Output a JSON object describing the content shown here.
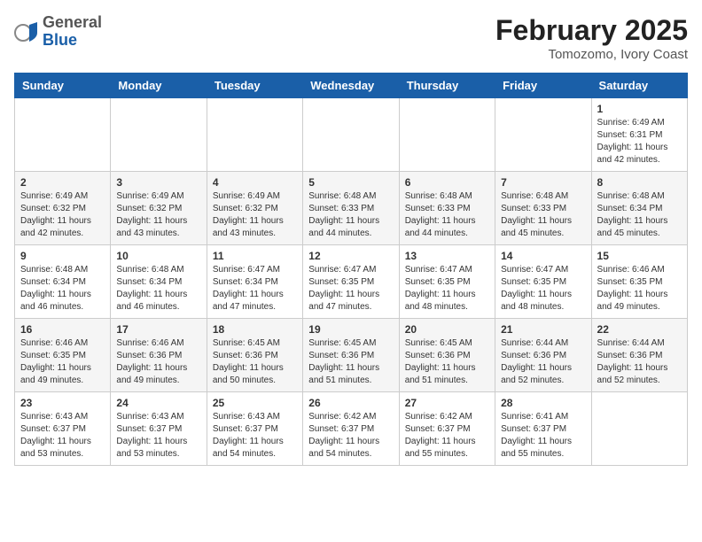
{
  "app": {
    "name_general": "General",
    "name_blue": "Blue"
  },
  "header": {
    "month_title": "February 2025",
    "location": "Tomozomo, Ivory Coast"
  },
  "days_of_week": [
    "Sunday",
    "Monday",
    "Tuesday",
    "Wednesday",
    "Thursday",
    "Friday",
    "Saturday"
  ],
  "weeks": [
    [
      {
        "day": "",
        "info": ""
      },
      {
        "day": "",
        "info": ""
      },
      {
        "day": "",
        "info": ""
      },
      {
        "day": "",
        "info": ""
      },
      {
        "day": "",
        "info": ""
      },
      {
        "day": "",
        "info": ""
      },
      {
        "day": "1",
        "info": "Sunrise: 6:49 AM\nSunset: 6:31 PM\nDaylight: 11 hours and 42 minutes."
      }
    ],
    [
      {
        "day": "2",
        "info": "Sunrise: 6:49 AM\nSunset: 6:32 PM\nDaylight: 11 hours and 42 minutes."
      },
      {
        "day": "3",
        "info": "Sunrise: 6:49 AM\nSunset: 6:32 PM\nDaylight: 11 hours and 43 minutes."
      },
      {
        "day": "4",
        "info": "Sunrise: 6:49 AM\nSunset: 6:32 PM\nDaylight: 11 hours and 43 minutes."
      },
      {
        "day": "5",
        "info": "Sunrise: 6:48 AM\nSunset: 6:33 PM\nDaylight: 11 hours and 44 minutes."
      },
      {
        "day": "6",
        "info": "Sunrise: 6:48 AM\nSunset: 6:33 PM\nDaylight: 11 hours and 44 minutes."
      },
      {
        "day": "7",
        "info": "Sunrise: 6:48 AM\nSunset: 6:33 PM\nDaylight: 11 hours and 45 minutes."
      },
      {
        "day": "8",
        "info": "Sunrise: 6:48 AM\nSunset: 6:34 PM\nDaylight: 11 hours and 45 minutes."
      }
    ],
    [
      {
        "day": "9",
        "info": "Sunrise: 6:48 AM\nSunset: 6:34 PM\nDaylight: 11 hours and 46 minutes."
      },
      {
        "day": "10",
        "info": "Sunrise: 6:48 AM\nSunset: 6:34 PM\nDaylight: 11 hours and 46 minutes."
      },
      {
        "day": "11",
        "info": "Sunrise: 6:47 AM\nSunset: 6:34 PM\nDaylight: 11 hours and 47 minutes."
      },
      {
        "day": "12",
        "info": "Sunrise: 6:47 AM\nSunset: 6:35 PM\nDaylight: 11 hours and 47 minutes."
      },
      {
        "day": "13",
        "info": "Sunrise: 6:47 AM\nSunset: 6:35 PM\nDaylight: 11 hours and 48 minutes."
      },
      {
        "day": "14",
        "info": "Sunrise: 6:47 AM\nSunset: 6:35 PM\nDaylight: 11 hours and 48 minutes."
      },
      {
        "day": "15",
        "info": "Sunrise: 6:46 AM\nSunset: 6:35 PM\nDaylight: 11 hours and 49 minutes."
      }
    ],
    [
      {
        "day": "16",
        "info": "Sunrise: 6:46 AM\nSunset: 6:35 PM\nDaylight: 11 hours and 49 minutes."
      },
      {
        "day": "17",
        "info": "Sunrise: 6:46 AM\nSunset: 6:36 PM\nDaylight: 11 hours and 49 minutes."
      },
      {
        "day": "18",
        "info": "Sunrise: 6:45 AM\nSunset: 6:36 PM\nDaylight: 11 hours and 50 minutes."
      },
      {
        "day": "19",
        "info": "Sunrise: 6:45 AM\nSunset: 6:36 PM\nDaylight: 11 hours and 51 minutes."
      },
      {
        "day": "20",
        "info": "Sunrise: 6:45 AM\nSunset: 6:36 PM\nDaylight: 11 hours and 51 minutes."
      },
      {
        "day": "21",
        "info": "Sunrise: 6:44 AM\nSunset: 6:36 PM\nDaylight: 11 hours and 52 minutes."
      },
      {
        "day": "22",
        "info": "Sunrise: 6:44 AM\nSunset: 6:36 PM\nDaylight: 11 hours and 52 minutes."
      }
    ],
    [
      {
        "day": "23",
        "info": "Sunrise: 6:43 AM\nSunset: 6:37 PM\nDaylight: 11 hours and 53 minutes."
      },
      {
        "day": "24",
        "info": "Sunrise: 6:43 AM\nSunset: 6:37 PM\nDaylight: 11 hours and 53 minutes."
      },
      {
        "day": "25",
        "info": "Sunrise: 6:43 AM\nSunset: 6:37 PM\nDaylight: 11 hours and 54 minutes."
      },
      {
        "day": "26",
        "info": "Sunrise: 6:42 AM\nSunset: 6:37 PM\nDaylight: 11 hours and 54 minutes."
      },
      {
        "day": "27",
        "info": "Sunrise: 6:42 AM\nSunset: 6:37 PM\nDaylight: 11 hours and 55 minutes."
      },
      {
        "day": "28",
        "info": "Sunrise: 6:41 AM\nSunset: 6:37 PM\nDaylight: 11 hours and 55 minutes."
      },
      {
        "day": "",
        "info": ""
      }
    ]
  ]
}
